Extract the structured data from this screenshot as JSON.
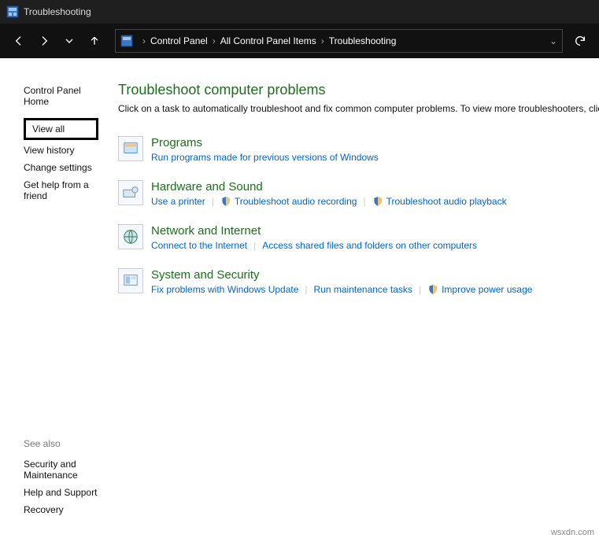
{
  "titlebar": {
    "title": "Troubleshooting"
  },
  "breadcrumb": {
    "item0": "Control Panel",
    "item1": "All Control Panel Items",
    "item2": "Troubleshooting"
  },
  "sidebar": {
    "home": "Control Panel Home",
    "view_all": "View all",
    "view_history": "View history",
    "change_settings": "Change settings",
    "get_help": "Get help from a friend"
  },
  "see_also": {
    "header": "See also",
    "security": "Security and Maintenance",
    "help": "Help and Support",
    "recovery": "Recovery"
  },
  "main": {
    "title": "Troubleshoot computer problems",
    "subtitle": "Click on a task to automatically troubleshoot and fix common computer problems. To view more troubleshooters, click on a category or use the Search box."
  },
  "categories": {
    "programs": {
      "title": "Programs",
      "l0": "Run programs made for previous versions of Windows"
    },
    "hardware": {
      "title": "Hardware and Sound",
      "l0": "Use a printer",
      "l1": "Troubleshoot audio recording",
      "l2": "Troubleshoot audio playback"
    },
    "network": {
      "title": "Network and Internet",
      "l0": "Connect to the Internet",
      "l1": "Access shared files and folders on other computers"
    },
    "system": {
      "title": "System and Security",
      "l0": "Fix problems with Windows Update",
      "l1": "Run maintenance tasks",
      "l2": "Improve power usage"
    }
  },
  "watermark": "wsxdn.com"
}
